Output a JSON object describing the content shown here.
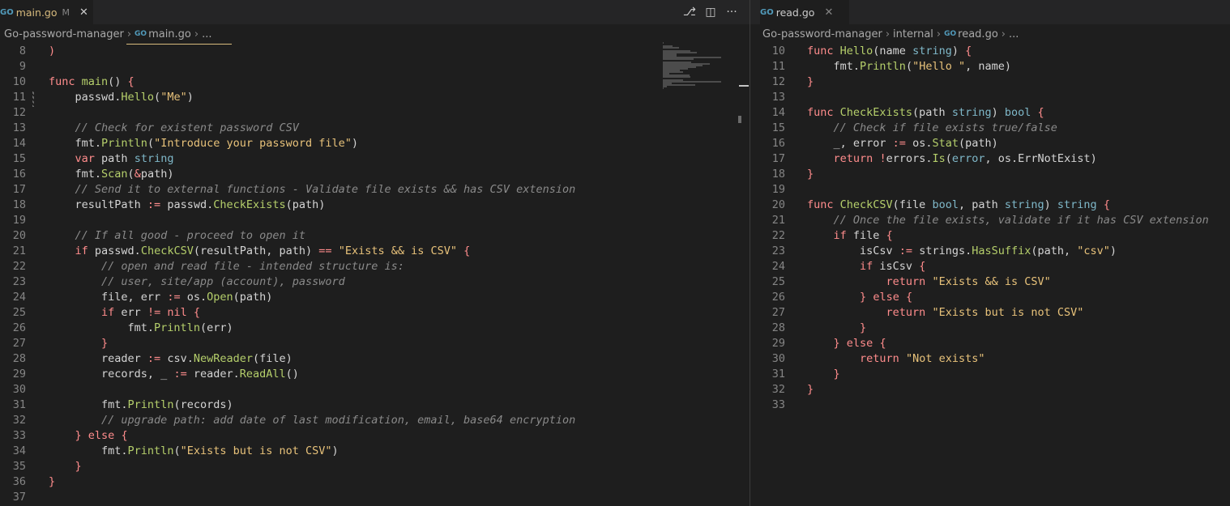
{
  "left": {
    "tab": {
      "icon": "go-file-icon",
      "filename": "main.go",
      "modified": "M"
    },
    "breadcrumb": [
      "Go-password-manager",
      "main.go",
      "..."
    ],
    "lines": [
      {
        "n": "8",
        "tokens": [
          [
            "br",
            ")"
          ]
        ]
      },
      {
        "n": "9",
        "tokens": []
      },
      {
        "n": "10",
        "tokens": [
          [
            "kw",
            "func "
          ],
          [
            "fn",
            "main"
          ],
          [
            "",
            "() "
          ],
          [
            "br",
            "{"
          ]
        ]
      },
      {
        "n": "11",
        "tokens": [
          [
            "",
            "    passwd."
          ],
          [
            "fn",
            "Hello"
          ],
          [
            "",
            "("
          ],
          [
            "str",
            "\"Me\""
          ],
          [
            "",
            ")"
          ]
        ]
      },
      {
        "n": "12",
        "tokens": []
      },
      {
        "n": "13",
        "tokens": [
          [
            "cmt",
            "    // Check for existent password CSV"
          ]
        ]
      },
      {
        "n": "14",
        "tokens": [
          [
            "",
            "    fmt."
          ],
          [
            "fn",
            "Println"
          ],
          [
            "",
            "("
          ],
          [
            "str",
            "\"Introduce your password file\""
          ],
          [
            "",
            ")"
          ]
        ]
      },
      {
        "n": "15",
        "tokens": [
          [
            "",
            "    "
          ],
          [
            "kw",
            "var"
          ],
          [
            "",
            " path "
          ],
          [
            "ty",
            "string"
          ]
        ]
      },
      {
        "n": "16",
        "tokens": [
          [
            "",
            "    fmt."
          ],
          [
            "fn",
            "Scan"
          ],
          [
            "",
            "("
          ],
          [
            "op",
            "&"
          ],
          [
            "",
            "path)"
          ]
        ]
      },
      {
        "n": "17",
        "tokens": [
          [
            "cmt",
            "    // Send it to external functions - Validate file exists && has CSV extension"
          ]
        ]
      },
      {
        "n": "18",
        "tokens": [
          [
            "",
            "    resultPath "
          ],
          [
            "op",
            ":="
          ],
          [
            "",
            " passwd."
          ],
          [
            "fn",
            "CheckExists"
          ],
          [
            "",
            "(path)"
          ]
        ]
      },
      {
        "n": "19",
        "tokens": []
      },
      {
        "n": "20",
        "tokens": [
          [
            "cmt",
            "    // If all good - proceed to open it"
          ]
        ]
      },
      {
        "n": "21",
        "tokens": [
          [
            "",
            "    "
          ],
          [
            "kw",
            "if"
          ],
          [
            "",
            " passwd."
          ],
          [
            "fn",
            "CheckCSV"
          ],
          [
            "",
            "(resultPath, path) "
          ],
          [
            "op",
            "=="
          ],
          [
            "",
            " "
          ],
          [
            "str",
            "\"Exists && is CSV\""
          ],
          [
            "",
            " "
          ],
          [
            "br",
            "{"
          ]
        ]
      },
      {
        "n": "22",
        "tokens": [
          [
            "cmt",
            "        // open and read file - intended structure is:"
          ]
        ]
      },
      {
        "n": "23",
        "tokens": [
          [
            "cmt",
            "        // user, site/app (account), password"
          ]
        ]
      },
      {
        "n": "24",
        "tokens": [
          [
            "",
            "        file, err "
          ],
          [
            "op",
            ":="
          ],
          [
            "",
            " os."
          ],
          [
            "fn",
            "Open"
          ],
          [
            "",
            "(path)"
          ]
        ]
      },
      {
        "n": "25",
        "tokens": [
          [
            "",
            "        "
          ],
          [
            "kw",
            "if"
          ],
          [
            "",
            " err "
          ],
          [
            "op",
            "!="
          ],
          [
            "",
            " "
          ],
          [
            "kw",
            "nil"
          ],
          [
            "",
            " "
          ],
          [
            "br",
            "{"
          ]
        ]
      },
      {
        "n": "26",
        "tokens": [
          [
            "",
            "            fmt."
          ],
          [
            "fn",
            "Println"
          ],
          [
            "",
            "(err)"
          ]
        ]
      },
      {
        "n": "27",
        "tokens": [
          [
            "",
            "        "
          ],
          [
            "br",
            "}"
          ]
        ]
      },
      {
        "n": "28",
        "tokens": [
          [
            "",
            "        reader "
          ],
          [
            "op",
            ":="
          ],
          [
            "",
            " csv."
          ],
          [
            "fn",
            "NewReader"
          ],
          [
            "",
            "(file)"
          ]
        ]
      },
      {
        "n": "29",
        "tokens": [
          [
            "",
            "        records, _ "
          ],
          [
            "op",
            ":="
          ],
          [
            "",
            " reader."
          ],
          [
            "fn",
            "ReadAll"
          ],
          [
            "",
            "()"
          ]
        ]
      },
      {
        "n": "30",
        "tokens": []
      },
      {
        "n": "31",
        "tokens": [
          [
            "",
            "        fmt."
          ],
          [
            "fn",
            "Println"
          ],
          [
            "",
            "(records)"
          ]
        ]
      },
      {
        "n": "32",
        "tokens": [
          [
            "cmt",
            "        // upgrade path: add date of last modification, email, base64 encryption"
          ]
        ]
      },
      {
        "n": "33",
        "tokens": [
          [
            "",
            "    "
          ],
          [
            "br",
            "}"
          ],
          [
            "",
            " "
          ],
          [
            "kw",
            "else"
          ],
          [
            "",
            " "
          ],
          [
            "br",
            "{"
          ]
        ]
      },
      {
        "n": "34",
        "tokens": [
          [
            "",
            "        fmt."
          ],
          [
            "fn",
            "Println"
          ],
          [
            "",
            "("
          ],
          [
            "str",
            "\"Exists but is not CSV\""
          ],
          [
            "",
            ")"
          ]
        ]
      },
      {
        "n": "35",
        "tokens": [
          [
            "",
            "    "
          ],
          [
            "br",
            "}"
          ]
        ]
      },
      {
        "n": "36",
        "tokens": [
          [
            "br",
            "}"
          ]
        ]
      },
      {
        "n": "37",
        "tokens": []
      }
    ]
  },
  "right": {
    "tab": {
      "icon": "go-file-icon",
      "filename": "read.go"
    },
    "breadcrumb": [
      "Go-password-manager",
      "internal",
      "read.go",
      "..."
    ],
    "lines": [
      {
        "n": "10",
        "tokens": [
          [
            "kw",
            "func "
          ],
          [
            "fn",
            "Hello"
          ],
          [
            "",
            "(name "
          ],
          [
            "ty",
            "string"
          ],
          [
            "",
            ") "
          ],
          [
            "br",
            "{"
          ]
        ]
      },
      {
        "n": "11",
        "tokens": [
          [
            "",
            "    fmt."
          ],
          [
            "fn",
            "Println"
          ],
          [
            "",
            "("
          ],
          [
            "str",
            "\"Hello \""
          ],
          [
            "",
            ", name)"
          ]
        ]
      },
      {
        "n": "12",
        "tokens": [
          [
            "br",
            "}"
          ]
        ]
      },
      {
        "n": "13",
        "tokens": []
      },
      {
        "n": "14",
        "tokens": [
          [
            "kw",
            "func "
          ],
          [
            "fn",
            "CheckExists"
          ],
          [
            "",
            "(path "
          ],
          [
            "ty",
            "string"
          ],
          [
            "",
            ") "
          ],
          [
            "ty",
            "bool"
          ],
          [
            "",
            " "
          ],
          [
            "br",
            "{"
          ]
        ]
      },
      {
        "n": "15",
        "tokens": [
          [
            "cmt",
            "    // Check if file exists true/false"
          ]
        ]
      },
      {
        "n": "16",
        "tokens": [
          [
            "",
            "    _, error "
          ],
          [
            "op",
            ":="
          ],
          [
            "",
            " os."
          ],
          [
            "fn",
            "Stat"
          ],
          [
            "",
            "(path)"
          ]
        ]
      },
      {
        "n": "17",
        "tokens": [
          [
            "",
            "    "
          ],
          [
            "kw",
            "return"
          ],
          [
            "",
            " "
          ],
          [
            "op",
            "!"
          ],
          [
            "",
            "errors."
          ],
          [
            "fn",
            "Is"
          ],
          [
            "",
            "("
          ],
          [
            "ty",
            "error"
          ],
          [
            "",
            ", os.ErrNotExist)"
          ]
        ]
      },
      {
        "n": "18",
        "tokens": [
          [
            "br",
            "}"
          ]
        ]
      },
      {
        "n": "19",
        "tokens": []
      },
      {
        "n": "20",
        "tokens": [
          [
            "kw",
            "func "
          ],
          [
            "fn",
            "CheckCSV"
          ],
          [
            "",
            "(file "
          ],
          [
            "ty",
            "bool"
          ],
          [
            "",
            ", path "
          ],
          [
            "ty",
            "string"
          ],
          [
            "",
            ") "
          ],
          [
            "ty",
            "string"
          ],
          [
            "",
            " "
          ],
          [
            "br",
            "{"
          ]
        ]
      },
      {
        "n": "21",
        "tokens": [
          [
            "cmt",
            "    // Once the file exists, validate if it has CSV extension"
          ]
        ]
      },
      {
        "n": "22",
        "tokens": [
          [
            "",
            "    "
          ],
          [
            "kw",
            "if"
          ],
          [
            "",
            " file "
          ],
          [
            "br",
            "{"
          ]
        ]
      },
      {
        "n": "23",
        "tokens": [
          [
            "",
            "        isCsv "
          ],
          [
            "op",
            ":="
          ],
          [
            "",
            " strings."
          ],
          [
            "fn",
            "HasSuffix"
          ],
          [
            "",
            "(path, "
          ],
          [
            "str",
            "\"csv\""
          ],
          [
            "",
            ")"
          ]
        ]
      },
      {
        "n": "24",
        "tokens": [
          [
            "",
            "        "
          ],
          [
            "kw",
            "if"
          ],
          [
            "",
            " isCsv "
          ],
          [
            "br",
            "{"
          ]
        ]
      },
      {
        "n": "25",
        "tokens": [
          [
            "",
            "            "
          ],
          [
            "kw",
            "return"
          ],
          [
            "",
            " "
          ],
          [
            "str",
            "\"Exists && is CSV\""
          ]
        ]
      },
      {
        "n": "26",
        "tokens": [
          [
            "",
            "        "
          ],
          [
            "br",
            "}"
          ],
          [
            "",
            " "
          ],
          [
            "kw",
            "else"
          ],
          [
            "",
            " "
          ],
          [
            "br",
            "{"
          ]
        ]
      },
      {
        "n": "27",
        "tokens": [
          [
            "",
            "            "
          ],
          [
            "kw",
            "return"
          ],
          [
            "",
            " "
          ],
          [
            "str",
            "\"Exists but is not CSV\""
          ]
        ]
      },
      {
        "n": "28",
        "tokens": [
          [
            "",
            "        "
          ],
          [
            "br",
            "}"
          ]
        ]
      },
      {
        "n": "29",
        "tokens": [
          [
            "",
            "    "
          ],
          [
            "br",
            "}"
          ],
          [
            "",
            " "
          ],
          [
            "kw",
            "else"
          ],
          [
            "",
            " "
          ],
          [
            "br",
            "{"
          ]
        ]
      },
      {
        "n": "30",
        "tokens": [
          [
            "",
            "        "
          ],
          [
            "kw",
            "return"
          ],
          [
            "",
            " "
          ],
          [
            "str",
            "\"Not exists\""
          ]
        ]
      },
      {
        "n": "31",
        "tokens": [
          [
            "",
            "    "
          ],
          [
            "br",
            "}"
          ]
        ]
      },
      {
        "n": "32",
        "tokens": [
          [
            "br",
            "}"
          ]
        ]
      },
      {
        "n": "33",
        "tokens": []
      }
    ]
  },
  "toolbar": {
    "icons": [
      "source-control-compare-icon",
      "split-editor-icon",
      "more-actions-icon"
    ]
  }
}
